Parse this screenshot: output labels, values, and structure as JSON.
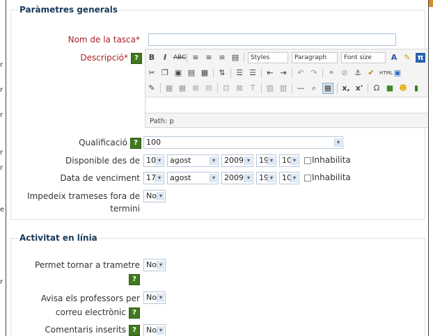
{
  "section_general": {
    "legend": "Paràmetres generals",
    "task_name_label": "Nom de la tasca*",
    "description_label": "Descripció*",
    "editor": {
      "styles": "Styles",
      "paragraph": "Paragraph",
      "font_size": "Font size",
      "path": "Path: p"
    },
    "grade_label": "Qualificació",
    "grade_value": "100",
    "available_from_label": "Disponible des de",
    "available_from": {
      "day": "10",
      "month": "agost",
      "year": "2009",
      "hour": "19",
      "minute": "10",
      "disable_label": "Inhabilita"
    },
    "due_date_label": "Data de venciment",
    "due_date": {
      "day": "17",
      "month": "agost",
      "year": "2009",
      "hour": "19",
      "minute": "10",
      "disable_label": "Inhabilita"
    },
    "prevent_late_label_1": "Impedeix trameses fora de",
    "prevent_late_label_2": "termini",
    "prevent_late_value": "No"
  },
  "section_online": {
    "legend": "Activitat en línia",
    "resubmit_label": "Permet tornar a trametre",
    "resubmit_value": "No",
    "notify_label_1": "Avisa els professors per",
    "notify_label_2": "correu electrònic",
    "notify_value": "No",
    "inline_comments_label": "Comentaris inserits",
    "inline_comments_value": "No"
  },
  "help_icon_glyph": "?",
  "colors": {
    "legend": "#1a3a5a",
    "required": "#a22222",
    "help": "#3f7a1e"
  }
}
